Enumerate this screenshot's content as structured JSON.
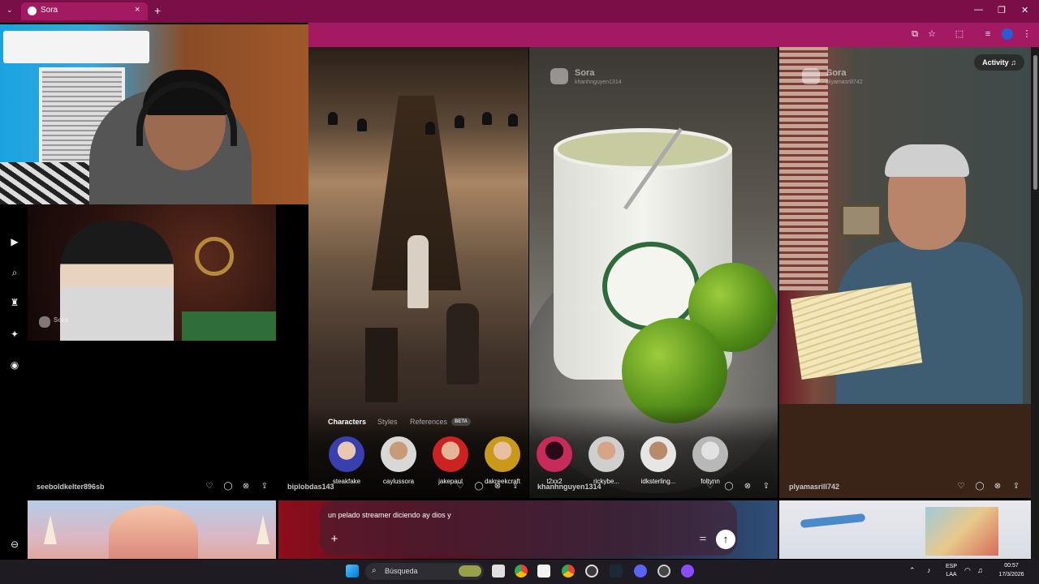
{
  "browser": {
    "tab_title": "Sora",
    "tab_close": "×",
    "new_tab": "+",
    "tab_menu": "⌄",
    "window_controls": {
      "minimize": "—",
      "restore": "❐",
      "close": "✕"
    },
    "toolbar_icons": [
      "install-icon",
      "star-icon",
      "extensions-icon",
      "media-icon",
      "profile-icon",
      "more-icon"
    ]
  },
  "sidebar": {
    "items": [
      {
        "icon": "home-icon",
        "glyph": "⌂"
      },
      {
        "icon": "search-icon",
        "glyph": "⌕"
      },
      {
        "icon": "trophy-icon",
        "glyph": "♜"
      },
      {
        "icon": "sparkle-icon",
        "glyph": "✦"
      },
      {
        "icon": "profile-icon",
        "glyph": "◉"
      }
    ],
    "bottom_icon": {
      "icon": "settings-icon",
      "glyph": "⊖"
    }
  },
  "header": {
    "activity_label": "Activity",
    "activity_icon": "bell-icon"
  },
  "feed": {
    "watermark_brand": "Sora",
    "watermark_users": [
      "",
      "khanhnguyen1314",
      "plyamasrill742"
    ],
    "tiles": [
      {
        "username": "seeboldkelter896sb"
      },
      {
        "username": "biplobdas143"
      },
      {
        "username": "khanhnguyen1314"
      },
      {
        "username": "plyamasrill742"
      }
    ],
    "row_icons": [
      "♡",
      "◯",
      "⊗",
      "⇪"
    ]
  },
  "composer": {
    "tabs": {
      "characters": "Characters",
      "styles": "Styles",
      "references": "References",
      "beta": "BETA"
    },
    "characters": [
      {
        "name": "steakfake",
        "color": "#3a3fb0",
        "skin": "#e8c8b0"
      },
      {
        "name": "caylussora",
        "color": "#d8d8d8",
        "skin": "#c89a78"
      },
      {
        "name": "jakepaul",
        "color": "#c22",
        "skin": "#e4b596"
      },
      {
        "name": "dakreekcraft",
        "color": "#c99a1a",
        "skin": "#e8c0a0"
      },
      {
        "name": "t2xx2",
        "color": "#c82a5a",
        "skin": "#2a0a18"
      },
      {
        "name": "rickybe...",
        "color": "#cfcfcf",
        "skin": "#d8a488"
      },
      {
        "name": "idksterling...",
        "color": "#e6e6e6",
        "skin": "#b88a6a"
      },
      {
        "name": "foltynn",
        "color": "#b8b8b8",
        "skin": "#e2e2e2"
      }
    ],
    "prompt_text": "un pelado streamer diciendo ay dios y",
    "add_label": "+",
    "send_label": "↑",
    "settings_label": "⚙"
  },
  "taskbar": {
    "search_label": "Búsqueda",
    "lang_top": "ESP",
    "lang_bottom": "LAA",
    "time": "00:57",
    "date": "17/3/2026",
    "apps": [
      "start-icon",
      "search-icon",
      "widget-icon",
      "files-icon",
      "chrome-icon",
      "capcut-icon",
      "chrome-alt-icon",
      "media-player-icon",
      "steam-icon",
      "discord-icon",
      "app-icon",
      "obs-icon"
    ]
  },
  "colors": {
    "tabbar": "#7a0f48",
    "toolbar": "#a31a63",
    "taskbar": "#1e1c22",
    "accent_blue": "#0078d4"
  }
}
